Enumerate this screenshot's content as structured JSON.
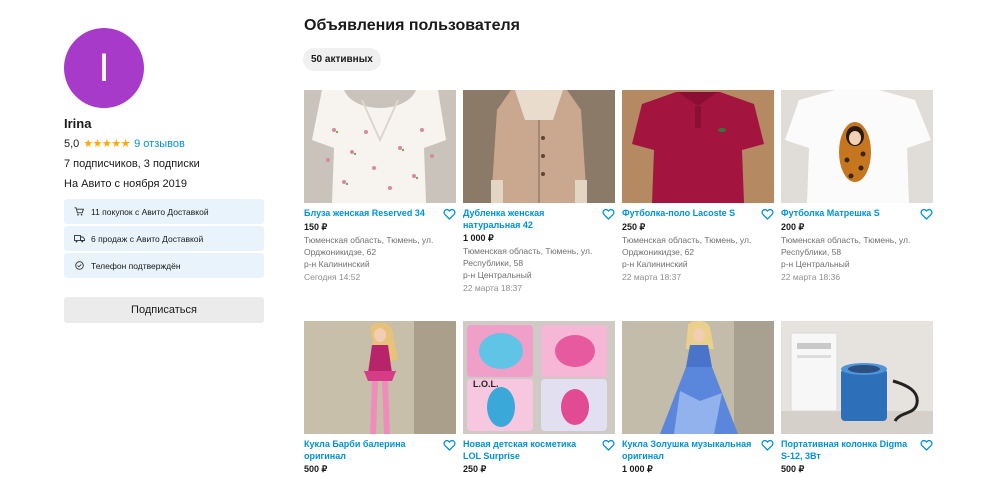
{
  "profile": {
    "avatar_letter": "I",
    "avatar_color": "#a83ac9",
    "name": "Irina",
    "rating": "5,0",
    "stars": "★★★★★",
    "reviews": "9 отзывов",
    "followers": "7 подписчиков, 3 подписки",
    "since": "На Авито с ноября 2019",
    "badges": [
      {
        "icon": "cart-icon",
        "text": "11 покупок с Авито Доставкой"
      },
      {
        "icon": "truck-icon",
        "text": "6 продаж с Авито Доставкой"
      },
      {
        "icon": "check-circle-icon",
        "text": "Телефон подтверждён"
      }
    ],
    "subscribe_label": "Подписаться"
  },
  "main": {
    "title": "Объявления пользователя",
    "active_chip": "50 активных"
  },
  "listings": [
    {
      "title": "Блуза женская Reserved 34",
      "price": "150 ₽",
      "location": "Тюменская область, Тюмень, ул. Орджоникидзе, 62\nр-н Калининский",
      "date": "Сегодня 14:52"
    },
    {
      "title": "Дубленка женская натуральная 42",
      "price": "1 000 ₽",
      "location": "Тюменская область, Тюмень, ул. Республики, 58\nр-н Центральный",
      "date": "22 марта 18:37"
    },
    {
      "title": "Футболка-поло Lacoste S",
      "price": "250 ₽",
      "location": "Тюменская область, Тюмень, ул. Орджоникидзе, 62\nр-н Калининский",
      "date": "22 марта 18:37"
    },
    {
      "title": "Футболка Матрешка S",
      "price": "200 ₽",
      "location": "Тюменская область, Тюмень, ул. Республики, 58\nр-н Центральный",
      "date": "22 марта 18:36"
    },
    {
      "title": "Кукла Барби балерина оригинал",
      "price": "500 ₽",
      "location": "",
      "date": ""
    },
    {
      "title": "Новая детская косметика LOL Surprise",
      "price": "250 ₽",
      "location": "",
      "date": ""
    },
    {
      "title": "Кукла Золушка музыкальная оригинал",
      "price": "1 000 ₽",
      "location": "",
      "date": ""
    },
    {
      "title": "Портативная колонка Digma S-12, 3Вт",
      "price": "500 ₽",
      "location": "",
      "date": ""
    }
  ]
}
